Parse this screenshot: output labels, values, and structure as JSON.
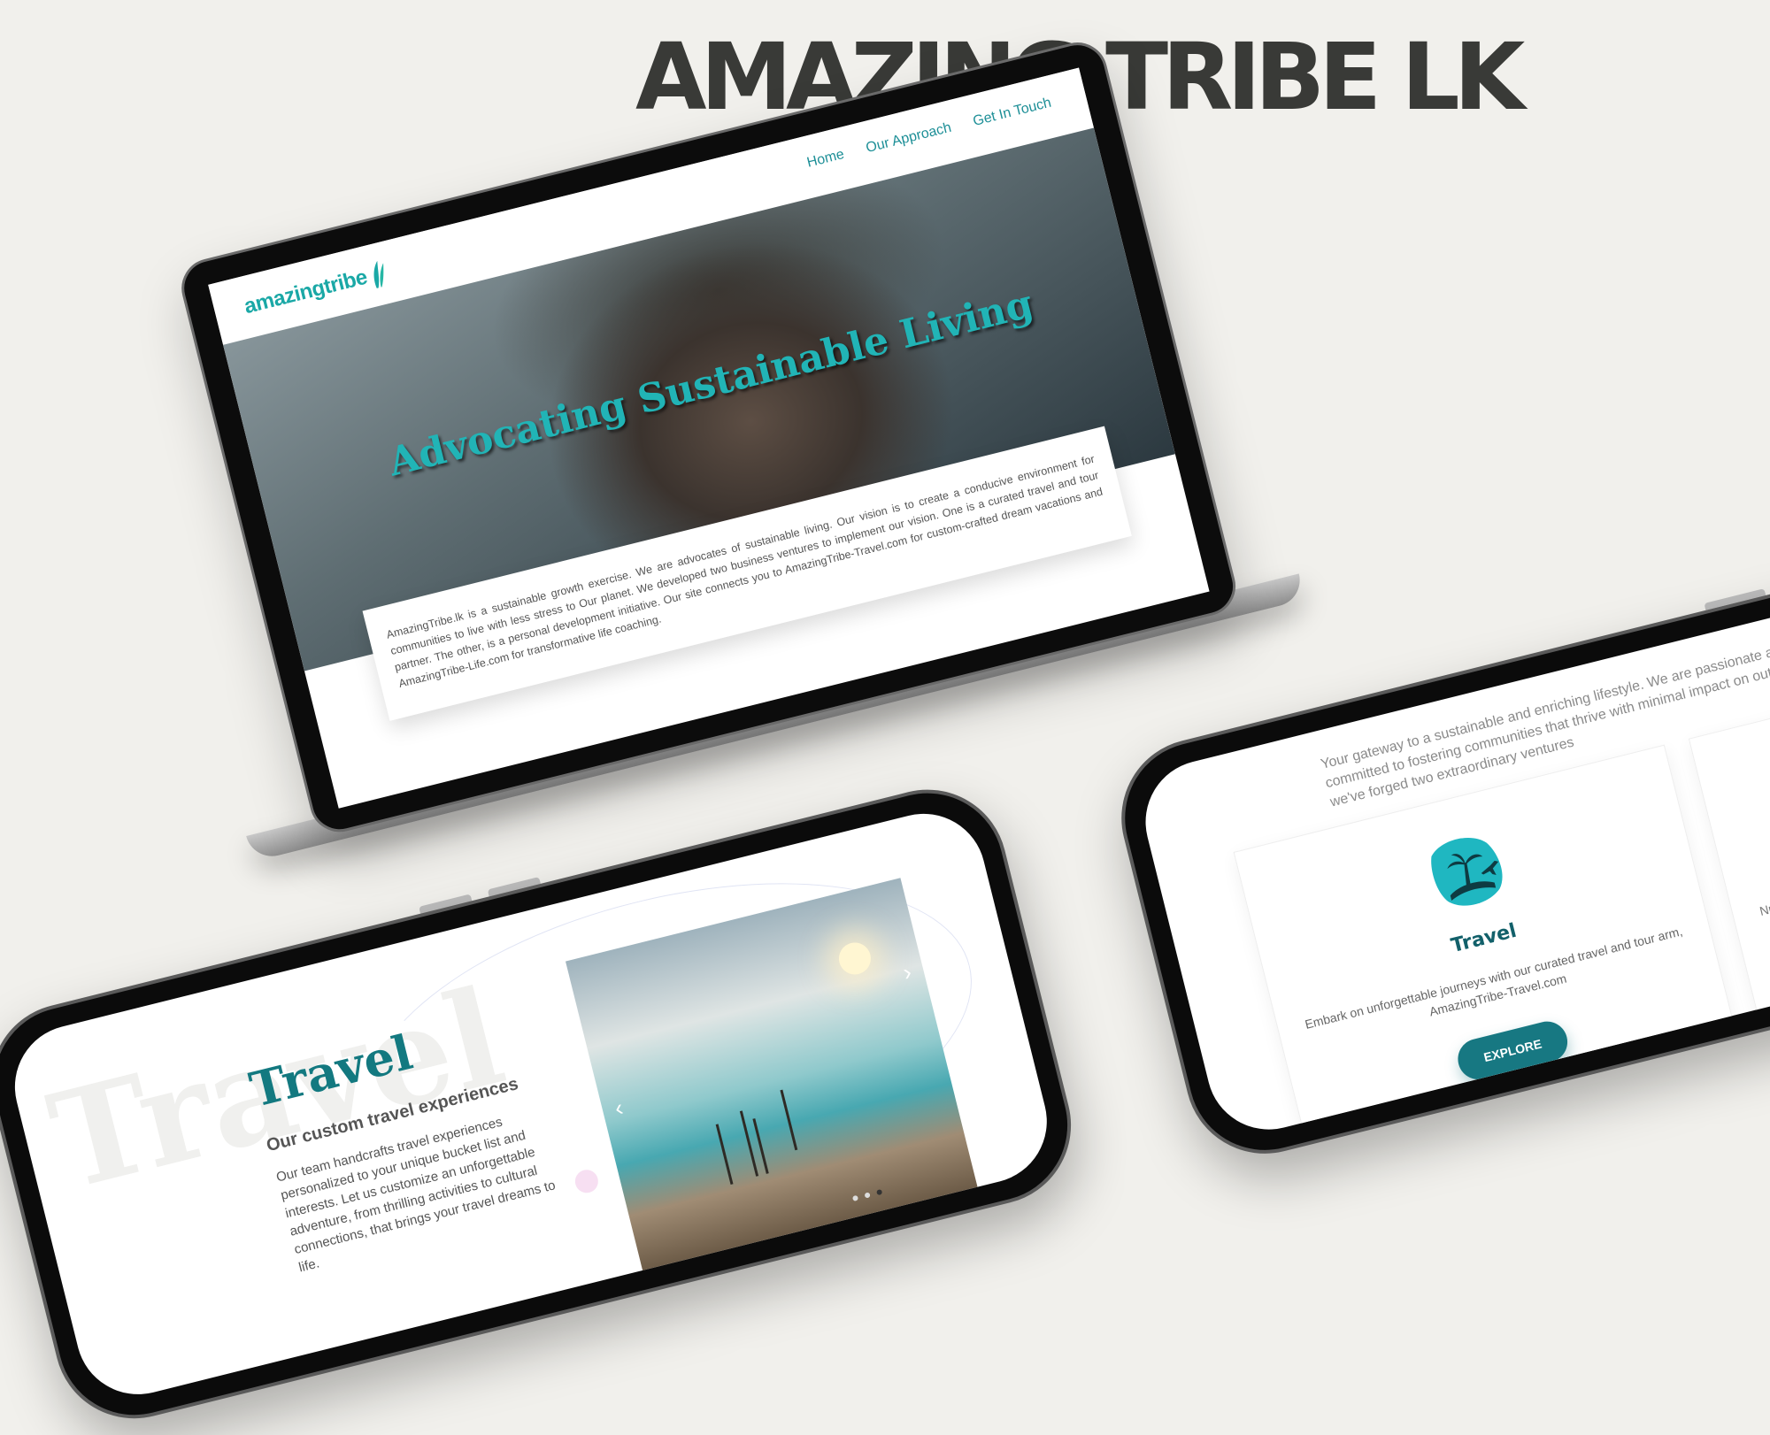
{
  "page": {
    "background_word": "AMAZ",
    "heading": "AMAZING TRIBE LK"
  },
  "laptop_site": {
    "logo_text": "amazingtribe",
    "nav": [
      "Home",
      "Our Approach",
      "Get In Touch"
    ],
    "hero_title": "Advocating Sustainable Living",
    "about_text": "AmazingTribe.lk is a sustainable growth exercise. We are advocates of sustainable living. Our vision is to create a conducive environment for communities to live with less stress to Our planet. We developed two business ventures to implement our vision. One is a curated travel and tour partner. The other, is a personal development initiative. Our site connects you to AmazingTribe-Travel.com for custom-crafted dream vacations and AmazingTribe-Life.com for transformative life coaching."
  },
  "phone_travel": {
    "background_word": "Travel",
    "title": "Travel",
    "subtitle": "Our custom travel experiences",
    "description": "Our team handcrafts travel experiences personalized to your unique bucket list and interests. Let us customize an unforgettable adventure, from thrilling activities to cultural connections, that brings your travel dreams to life.",
    "slider_prev": "‹",
    "slider_next": "›",
    "slider_dots": 3,
    "slider_active_dot": 3
  },
  "phone_ventures": {
    "intro": "Your gateway to a sustainable and enriching lifestyle. We are passionate advocates of sustainable living, committed to fostering communities that thrive with minimal impact on out precious planet. Guided by this vision, we've forged two extraordinary ventures",
    "card": {
      "icon": "island-plane-icon",
      "title": "Travel",
      "text": "Embark on unforgettable journeys with our curated travel and tour arm, AmazingTribe-Travel.com",
      "button": "EXPLORE"
    },
    "card2_text": "Nurture you"
  },
  "colors": {
    "background": "#f1f0ec",
    "heading": "#393a37",
    "teal_accent": "#1aa8a6",
    "button": "#177882"
  }
}
